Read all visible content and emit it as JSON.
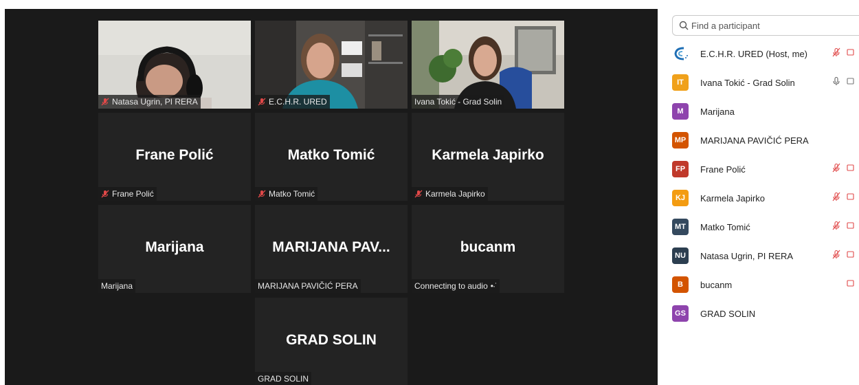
{
  "tiles": [
    {
      "type": "video",
      "label": "Natasa Ugrin, PI RERA",
      "muted": true
    },
    {
      "type": "video",
      "label": "E.C.H.R. URED",
      "muted": true
    },
    {
      "type": "video",
      "label": "Ivana Tokić - Grad Solin",
      "muted": false,
      "active": true
    },
    {
      "type": "name",
      "name": "Frane Polić",
      "label": "Frane Polić",
      "muted": true
    },
    {
      "type": "name",
      "name": "Matko Tomić",
      "label": "Matko Tomić",
      "muted": true
    },
    {
      "type": "name",
      "name": "Karmela Japirko",
      "label": "Karmela Japirko",
      "muted": true
    },
    {
      "type": "name",
      "name": "Marijana",
      "label": "Marijana",
      "muted": false
    },
    {
      "type": "name",
      "name": "MARIJANA  PAV...",
      "label": "MARIJANA PAVIČIĆ PERA",
      "muted": false
    },
    {
      "type": "name",
      "name": "bucanm",
      "label": "Connecting to audio",
      "label_suffix": "•·˙",
      "muted": false
    },
    {
      "type": "name",
      "name": "GRAD SOLIN",
      "label": "GRAD SOLIN",
      "muted": false
    }
  ],
  "search": {
    "placeholder": "Find a participant"
  },
  "participants": [
    {
      "initials": "",
      "logo": true,
      "name": "E.C.H.R. URED (Host, me)",
      "color": "#1f6fb5",
      "mic": "muted",
      "video": true
    },
    {
      "initials": "IT",
      "name": "Ivana Tokić - Grad Solin",
      "color": "#f0a11b",
      "mic": "on",
      "video": true
    },
    {
      "initials": "M",
      "name": "Marijana",
      "color": "#8e44ad",
      "mic": "none",
      "video": false
    },
    {
      "initials": "MP",
      "name": "MARIJANA PAVIČIĆ PERA",
      "color": "#d35400",
      "mic": "none",
      "video": false
    },
    {
      "initials": "FP",
      "name": "Frane Polić",
      "color": "#c0392b",
      "mic": "muted",
      "video": true
    },
    {
      "initials": "KJ",
      "name": "Karmela Japirko",
      "color": "#f39c12",
      "mic": "muted",
      "video": true
    },
    {
      "initials": "MT",
      "name": "Matko Tomić",
      "color": "#34495e",
      "mic": "muted",
      "video": true
    },
    {
      "initials": "NU",
      "name": "Natasa Ugrin, PI RERA",
      "color": "#2c3e50",
      "mic": "muted",
      "video": true
    },
    {
      "initials": "B",
      "name": "bucanm",
      "color": "#d35400",
      "mic": "none",
      "video": true
    },
    {
      "initials": "GS",
      "name": "GRAD SOLIN",
      "color": "#8e44ad",
      "mic": "none",
      "video": false
    }
  ]
}
